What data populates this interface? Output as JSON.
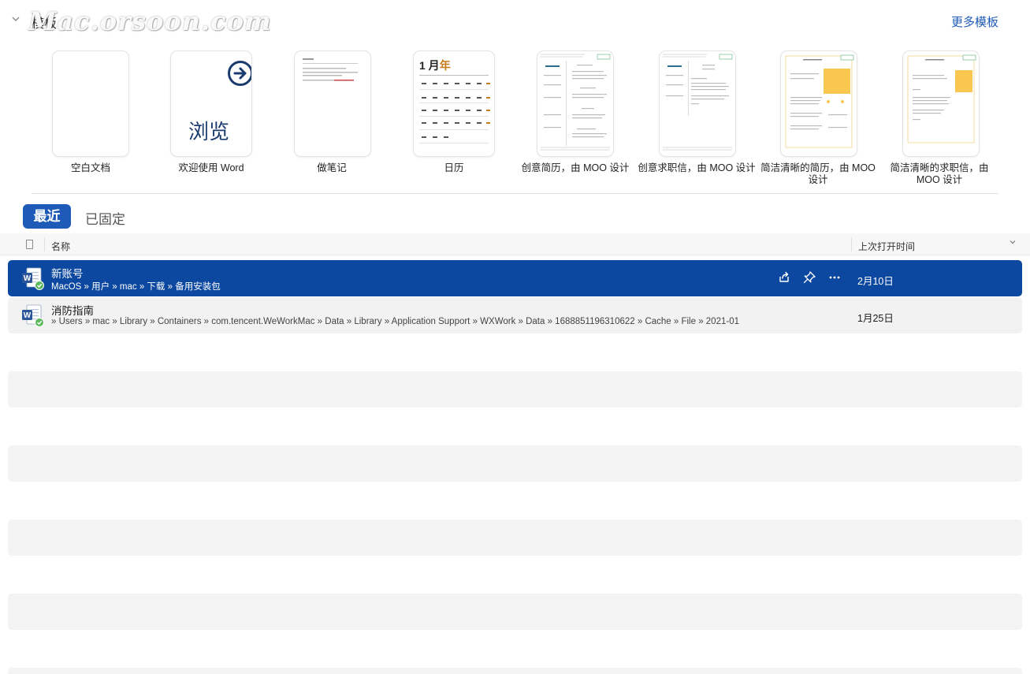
{
  "watermark": "Mac.orsoon.com",
  "header": {
    "section_title": "模板",
    "more_templates": "更多模板"
  },
  "templates": [
    {
      "label": "空白文档"
    },
    {
      "label": "欢迎使用 Word",
      "thumb_text": "浏览"
    },
    {
      "label": "做笔记"
    },
    {
      "label": "日历",
      "thumb_month": "1 月",
      "thumb_year": "年"
    },
    {
      "label": "创意简历，由 MOO 设计"
    },
    {
      "label": "创意求职信，由 MOO 设计"
    },
    {
      "label": "简洁清晰的简历，由 MOO 设计"
    },
    {
      "label": "简洁清晰的求职信，由 MOO 设计"
    }
  ],
  "tabs": {
    "recent": "最近",
    "pinned": "已固定"
  },
  "list_header": {
    "name": "名称",
    "last_opened": "上次打开时间"
  },
  "files": [
    {
      "name": "新账号",
      "path": "MacOS » 用户 » mac » 下载 » 备用安装包",
      "date": "2月10日",
      "selected": true
    },
    {
      "name": "消防指南",
      "path": " » Users » mac » Library » Containers » com.tencent.WeWorkMac » Data » Library » Application Support » WXWork » Data » 1688851196310622 » Cache » File » 2021-01",
      "date": "1月25日",
      "selected": false
    }
  ],
  "icons": {
    "file": "word-document-icon",
    "share": "share-icon",
    "pin": "pin-icon",
    "more": "more-icon"
  },
  "colors": {
    "accent": "#1e5bb8",
    "selected_row": "#0d48a0",
    "word_blue": "#2b579a",
    "check_green": "#5cb85c"
  }
}
